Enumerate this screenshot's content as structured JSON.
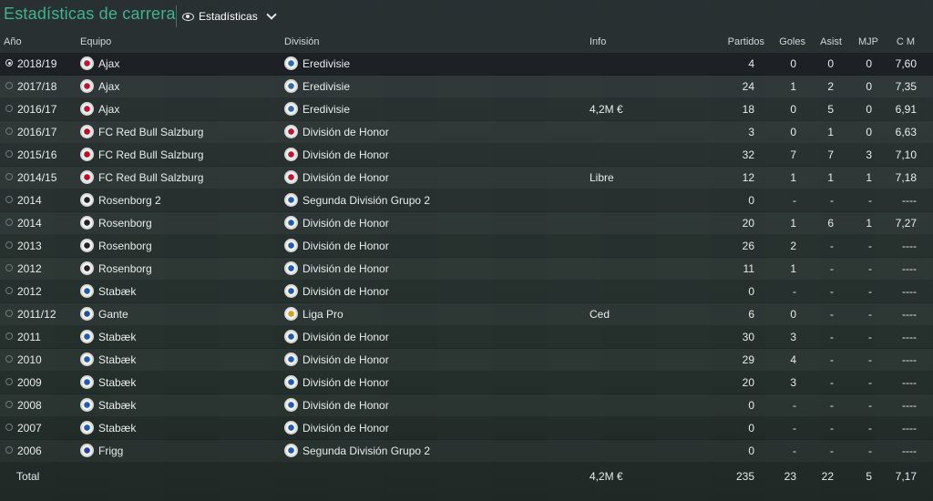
{
  "title": "Estadísticas de carrera",
  "view_select": {
    "label": "Estadísticas",
    "icon": "eye-icon"
  },
  "columns": {
    "year": "Año",
    "team": "Equipo",
    "division": "División",
    "info": "Info",
    "apps": "Partidos",
    "goals": "Goles",
    "assists": "Asist",
    "pom": "MJP",
    "avg": "C M"
  },
  "colors": {
    "accent": "#3fb48c",
    "selected_row": "#1c2024"
  },
  "rows": [
    {
      "year": "2018/19",
      "team": "Ajax",
      "team_crest": "ajax-crest",
      "division": "Eredivisie",
      "div_crest": "eredivisie-logo",
      "info": "",
      "apps": "4",
      "goals": "0",
      "assists": "0",
      "pom": "0",
      "avg": "7,60",
      "selected": true
    },
    {
      "year": "2017/18",
      "team": "Ajax",
      "team_crest": "ajax-crest",
      "division": "Eredivisie",
      "div_crest": "eredivisie-logo",
      "info": "",
      "apps": "24",
      "goals": "1",
      "assists": "2",
      "pom": "0",
      "avg": "7,35"
    },
    {
      "year": "2016/17",
      "team": "Ajax",
      "team_crest": "ajax-crest",
      "division": "Eredivisie",
      "div_crest": "eredivisie-logo",
      "info": "4,2M €",
      "apps": "18",
      "goals": "0",
      "assists": "5",
      "pom": "0",
      "avg": "6,91"
    },
    {
      "year": "2016/17",
      "team": "FC Red Bull Salzburg",
      "team_crest": "salzburg-crest",
      "division": "División de Honor",
      "div_crest": "austria-league-logo",
      "info": "",
      "apps": "3",
      "goals": "0",
      "assists": "1",
      "pom": "0",
      "avg": "6,63"
    },
    {
      "year": "2015/16",
      "team": "FC Red Bull Salzburg",
      "team_crest": "salzburg-crest",
      "division": "División de Honor",
      "div_crest": "austria-league-logo",
      "info": "",
      "apps": "32",
      "goals": "7",
      "assists": "7",
      "pom": "3",
      "avg": "7,10"
    },
    {
      "year": "2014/15",
      "team": "FC Red Bull Salzburg",
      "team_crest": "salzburg-crest",
      "division": "División de Honor",
      "div_crest": "austria-league-logo",
      "info": "Libre",
      "apps": "12",
      "goals": "1",
      "assists": "1",
      "pom": "1",
      "avg": "7,18"
    },
    {
      "year": "2014",
      "team": "Rosenborg 2",
      "team_crest": "rosenborg-crest",
      "division": "Segunda División Grupo 2",
      "div_crest": "norway-league-logo",
      "info": "",
      "apps": "0",
      "goals": "-",
      "assists": "-",
      "pom": "-",
      "avg": "----"
    },
    {
      "year": "2014",
      "team": "Rosenborg",
      "team_crest": "rosenborg-crest",
      "division": "División de Honor",
      "div_crest": "norway-league-logo",
      "info": "",
      "apps": "20",
      "goals": "1",
      "assists": "6",
      "pom": "1",
      "avg": "7,27"
    },
    {
      "year": "2013",
      "team": "Rosenborg",
      "team_crest": "rosenborg-crest",
      "division": "División de Honor",
      "div_crest": "norway-league-logo",
      "info": "",
      "apps": "26",
      "goals": "2",
      "assists": "-",
      "pom": "-",
      "avg": "----"
    },
    {
      "year": "2012",
      "team": "Rosenborg",
      "team_crest": "rosenborg-crest",
      "division": "División de Honor",
      "div_crest": "norway-league-logo",
      "info": "",
      "apps": "11",
      "goals": "1",
      "assists": "-",
      "pom": "-",
      "avg": "----"
    },
    {
      "year": "2012",
      "team": "Stabæk",
      "team_crest": "stabaek-crest",
      "division": "División de Honor",
      "div_crest": "norway-league-logo",
      "info": "",
      "apps": "0",
      "goals": "-",
      "assists": "-",
      "pom": "-",
      "avg": "----"
    },
    {
      "year": "2011/12",
      "team": "Gante",
      "team_crest": "gent-crest",
      "division": "Liga Pro",
      "div_crest": "belgium-league-logo",
      "info": "Ced",
      "apps": "6",
      "goals": "0",
      "assists": "-",
      "pom": "-",
      "avg": "----"
    },
    {
      "year": "2011",
      "team": "Stabæk",
      "team_crest": "stabaek-crest",
      "division": "División de Honor",
      "div_crest": "norway-league-logo",
      "info": "",
      "apps": "30",
      "goals": "3",
      "assists": "-",
      "pom": "-",
      "avg": "----"
    },
    {
      "year": "2010",
      "team": "Stabæk",
      "team_crest": "stabaek-crest",
      "division": "División de Honor",
      "div_crest": "norway-league-logo",
      "info": "",
      "apps": "29",
      "goals": "4",
      "assists": "-",
      "pom": "-",
      "avg": "----"
    },
    {
      "year": "2009",
      "team": "Stabæk",
      "team_crest": "stabaek-crest",
      "division": "División de Honor",
      "div_crest": "norway-league-logo",
      "info": "",
      "apps": "20",
      "goals": "3",
      "assists": "-",
      "pom": "-",
      "avg": "----"
    },
    {
      "year": "2008",
      "team": "Stabæk",
      "team_crest": "stabaek-crest",
      "division": "División de Honor",
      "div_crest": "norway-league-logo",
      "info": "",
      "apps": "0",
      "goals": "-",
      "assists": "-",
      "pom": "-",
      "avg": "----"
    },
    {
      "year": "2007",
      "team": "Stabæk",
      "team_crest": "stabaek-crest",
      "division": "División de Honor",
      "div_crest": "norway-league-logo",
      "info": "",
      "apps": "0",
      "goals": "-",
      "assists": "-",
      "pom": "-",
      "avg": "----"
    },
    {
      "year": "2006",
      "team": "Frigg",
      "team_crest": "frigg-crest",
      "division": "Segunda División Grupo 2",
      "div_crest": "norway-league-logo",
      "info": "",
      "apps": "0",
      "goals": "-",
      "assists": "-",
      "pom": "-",
      "avg": "----"
    }
  ],
  "total": {
    "label": "Total",
    "info": "4,2M €",
    "apps": "235",
    "goals": "23",
    "assists": "22",
    "pom": "5",
    "avg": "7,17"
  }
}
